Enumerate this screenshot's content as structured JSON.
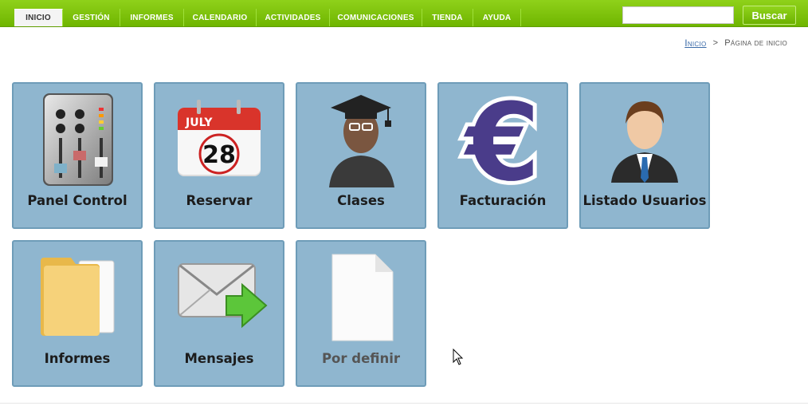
{
  "nav": {
    "tabs": [
      {
        "label": "INICIO",
        "active": true
      },
      {
        "label": "GESTIÓN",
        "active": false
      },
      {
        "label": "INFORMES",
        "active": false
      },
      {
        "label": "CALENDARIO",
        "active": false
      },
      {
        "label": "ACTIVIDADES",
        "active": false
      },
      {
        "label": "COMUNICACIONES",
        "active": false
      },
      {
        "label": "TIENDA",
        "active": false
      },
      {
        "label": "AYUDA",
        "active": false
      }
    ],
    "search_value": "",
    "search_button": "Buscar"
  },
  "breadcrumb": {
    "home": "Inicio",
    "separator": ">",
    "current": "Página de inicio"
  },
  "tiles": [
    {
      "label": "Panel Control",
      "icon": "mixer-panel-icon"
    },
    {
      "label": "Reservar",
      "icon": "calendar-icon",
      "calendar_month": "JULY",
      "calendar_day": "28"
    },
    {
      "label": "Clases",
      "icon": "graduate-icon"
    },
    {
      "label": "Facturación",
      "icon": "euro-icon"
    },
    {
      "label": "Listado Usuarios",
      "icon": "user-icon"
    },
    {
      "label": "Informes",
      "icon": "folder-icon"
    },
    {
      "label": "Mensajes",
      "icon": "mail-icon"
    },
    {
      "label": "Por definir",
      "icon": "blank-document-icon"
    }
  ],
  "colors": {
    "nav_green": "#7cc10a",
    "tile_bg": "#8fb6cf",
    "tile_border": "#6e9cb8"
  }
}
